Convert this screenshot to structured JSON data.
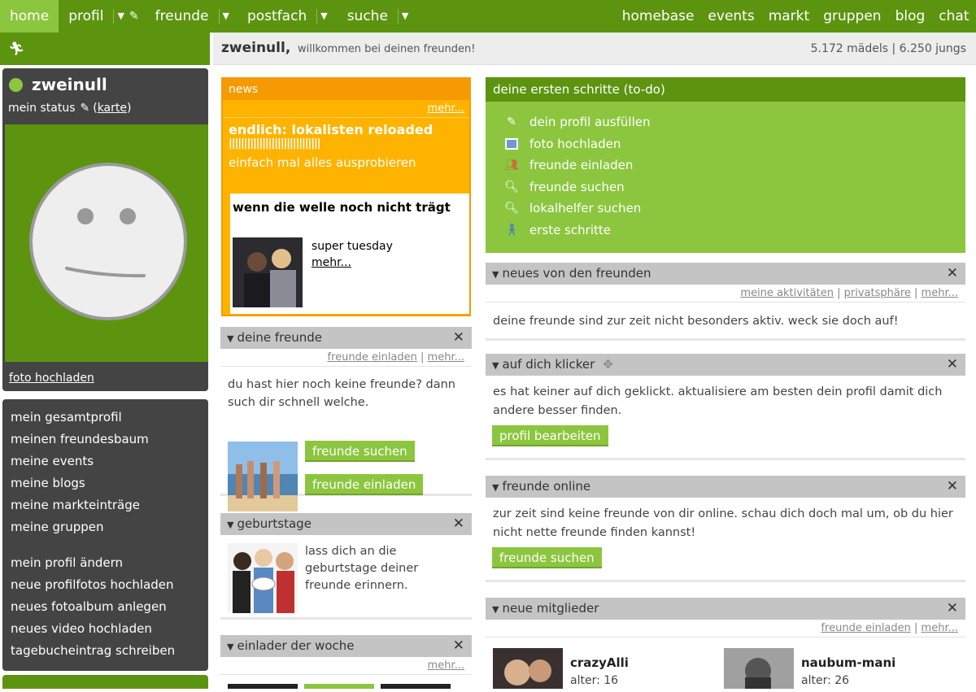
{
  "nav": {
    "left": [
      {
        "label": "home",
        "dropdown": false
      },
      {
        "label": "profil",
        "dropdown": true
      },
      {
        "label": "freunde",
        "dropdown": true
      },
      {
        "label": "postfach",
        "dropdown": true
      },
      {
        "label": "suche",
        "dropdown": true
      }
    ],
    "right": [
      "homebase",
      "events",
      "markt",
      "gruppen",
      "blog",
      "chat"
    ]
  },
  "profile": {
    "name": "zweinull",
    "status_label": "mein status",
    "karte_link": "karte",
    "photo_link": "foto hochladen"
  },
  "menu": {
    "group1": [
      "mein gesamtprofil",
      "meinen freundesbaum",
      "meine events",
      "meine blogs",
      "meine markteinträge",
      "meine gruppen"
    ],
    "group2": [
      "mein profil ändern",
      "neue profilfotos hochladen",
      "neues fotoalbum anlegen",
      "neues video hochladen",
      "tagebucheintrag schreiben"
    ]
  },
  "welcome": {
    "title": "zweinull,",
    "subtitle": "willkommen bei deinen freunden!",
    "stats": "5.172 mädels | 6.250 jungs"
  },
  "news": {
    "header": "news",
    "more": "mehr...",
    "headline": "endlich: lokalisten reloaded",
    "bars": "||||||||||||||||||||||||||||||",
    "subline": "einfach mal alles ausprobieren",
    "card_title": "wenn die welle noch nicht trägt",
    "card_text": "super tuesday",
    "card_more": "mehr..."
  },
  "freunde": {
    "title": "deine freunde",
    "link_invite": "freunde einladen",
    "link_more": "mehr...",
    "text": "du hast hier noch keine freunde? dann such dir schnell welche.",
    "btn_search": "freunde suchen",
    "btn_invite": "freunde einladen"
  },
  "geburtstage": {
    "title": "geburtstage",
    "text": "lass dich an die geburtstage deiner freunde erinnern."
  },
  "einlader": {
    "title": "einlader der woche",
    "more": "mehr..."
  },
  "todo": {
    "header": "deine ersten schritte (to-do)",
    "items": [
      {
        "label": "dein profil ausfüllen",
        "icon": "pencil-icon"
      },
      {
        "label": "foto hochladen",
        "icon": "photo-icon"
      },
      {
        "label": "freunde einladen",
        "icon": "people-icon"
      },
      {
        "label": "freunde suchen",
        "icon": "magnifier-icon"
      },
      {
        "label": "lokalhelfer suchen",
        "icon": "magnifier-icon"
      },
      {
        "label": "erste schritte",
        "icon": "walker-icon"
      }
    ]
  },
  "neues": {
    "title": "neues von den freunden",
    "links": [
      "meine aktivitäten",
      "privatsphäre",
      "mehr..."
    ],
    "text": "deine freunde sind zur zeit nicht besonders aktiv. weck sie doch auf!"
  },
  "klicker": {
    "title": "auf dich klicker",
    "text": "es hat keiner auf dich geklickt. aktualisiere am besten dein profil damit dich andere besser finden.",
    "button": "profil bearbeiten"
  },
  "online": {
    "title": "freunde online",
    "text": "zur zeit sind keine freunde von dir online. schau dich doch mal um, ob du hier nicht nette freunde finden kannst!",
    "button": "freunde suchen"
  },
  "mitglieder": {
    "title": "neue mitglieder",
    "link_invite": "freunde einladen",
    "link_more": "mehr...",
    "members": [
      {
        "name": "crazyAlli",
        "age": "alter: 16"
      },
      {
        "name": "naubum-mani",
        "age": "alter: 26"
      }
    ]
  },
  "colors": {
    "brand_green": "#5c9410",
    "light_green": "#8cc63f",
    "news_orange": "#fdb300",
    "dark_panel": "#444444"
  }
}
